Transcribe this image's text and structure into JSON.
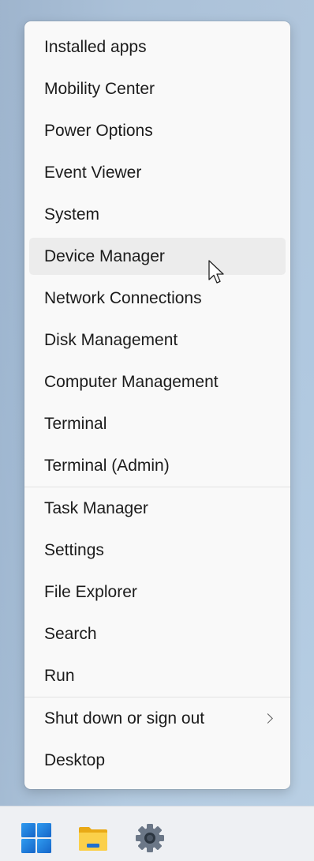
{
  "context_menu": {
    "group1": [
      {
        "label": "Installed apps"
      },
      {
        "label": "Mobility Center"
      },
      {
        "label": "Power Options"
      },
      {
        "label": "Event Viewer"
      },
      {
        "label": "System"
      },
      {
        "label": "Device Manager",
        "hovered": true
      },
      {
        "label": "Network Connections"
      },
      {
        "label": "Disk Management"
      },
      {
        "label": "Computer Management"
      },
      {
        "label": "Terminal"
      },
      {
        "label": "Terminal (Admin)"
      }
    ],
    "group2": [
      {
        "label": "Task Manager"
      },
      {
        "label": "Settings"
      },
      {
        "label": "File Explorer"
      },
      {
        "label": "Search"
      },
      {
        "label": "Run"
      }
    ],
    "group3": [
      {
        "label": "Shut down or sign out",
        "submenu": true
      },
      {
        "label": "Desktop"
      }
    ]
  },
  "taskbar": {
    "icons": [
      "windows-start-icon",
      "file-explorer-icon",
      "settings-gear-icon"
    ]
  },
  "colors": {
    "menu_background": "#f9f9f9",
    "hover_background": "#ececec",
    "text": "#1b1b1b",
    "taskbar_background": "#eef0f3",
    "start_blue": "#1f7ad6",
    "folder_yellow": "#f5c22a"
  }
}
